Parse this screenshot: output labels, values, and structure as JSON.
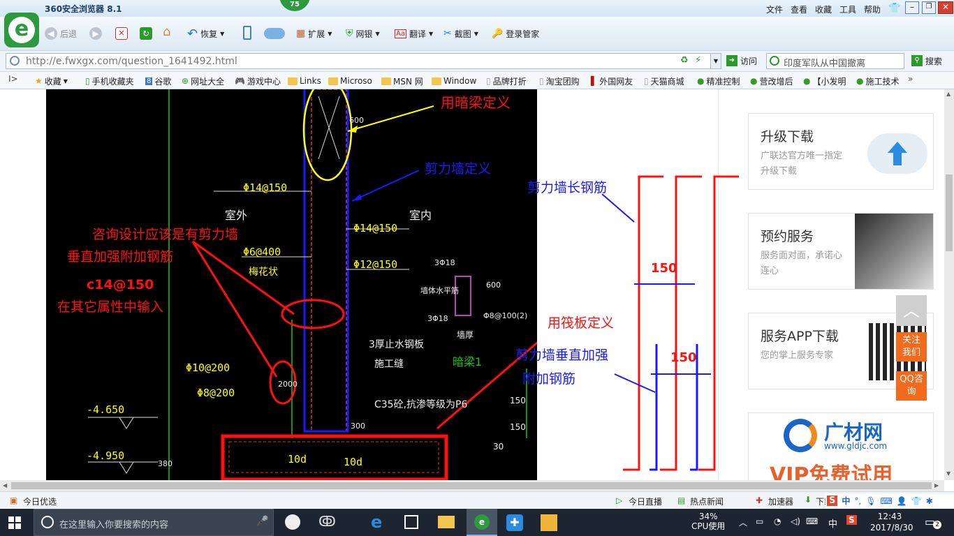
{
  "browser": {
    "title": "360安全浏览器 8.1",
    "badge": "75",
    "menu": [
      "文件",
      "查看",
      "收藏",
      "工具",
      "帮助"
    ],
    "nav": {
      "back": "后退",
      "restore": "恢复"
    },
    "tools": [
      "扩展",
      "网银",
      "翻译",
      "截图",
      "登录管家"
    ],
    "address": "http://e.fwxgx.com/question_1641492.html",
    "visit": "访问",
    "search_placeholder": "印度军队从中国撤离",
    "search_button": "搜索",
    "favorites": [
      "收藏",
      "手机收藏夹",
      "谷歌",
      "网址大全",
      "游戏中心",
      "Links",
      "Microso",
      "MSN 网",
      "Window",
      "品牌打折",
      "淘宝团购",
      "外国网友",
      "天猫商城",
      "精准控制",
      "营改增后",
      "【小发明",
      "施工技术"
    ]
  },
  "drawing": {
    "labels_red": [
      "用暗梁定义",
      "咨询设计应该是有剪力墙",
      "垂直加强附加钢筋",
      "c14@150",
      "在其它属性中输入",
      "用筏板定义"
    ],
    "labels_blue": [
      "剪力墙定义",
      "剪力墙垂直加强",
      "附加钢筋"
    ],
    "cad_text": [
      "Φ14@150",
      "室外",
      "室内",
      "Φ14@150",
      "Φ6@400",
      "梅花状",
      "Φ12@150",
      "3Φ18",
      "墙体水平筋",
      "3Φ18",
      "Φ8@100(2)",
      "600",
      "3厚止水钢板",
      "施工缝",
      "墙厚",
      "暗梁1",
      "C35砼,抗渗等级为P6",
      "Φ10@200",
      "Φ8@200",
      "2000",
      "300",
      "150",
      "150",
      "30",
      "10d",
      "10d",
      "-4.650",
      "-4.950",
      "380",
      "600"
    ],
    "sketch": {
      "title": "剪力墙长钢筋",
      "dim1": "150",
      "dim2": "150"
    }
  },
  "sidebar": {
    "cards": [
      {
        "title": "升级下载",
        "sub": "广联达官方唯一指定升级下载"
      },
      {
        "title": "预约服务",
        "sub": "服务面对面，承诺心连心"
      },
      {
        "title": "服务APP下载",
        "sub": "您的掌上服务专家"
      }
    ],
    "float": {
      "follow": "关注我们",
      "qq": "QQ咨询"
    },
    "ad": {
      "brand": "广材网",
      "url": "www.gldjc.com",
      "vip": "VIP免费试用"
    }
  },
  "statusbar": {
    "left": "今日优选",
    "items": [
      "今日直播",
      "热点新闻",
      "加速器",
      "下载"
    ]
  },
  "taskbar": {
    "search": "在这里输入你要搜索的内容",
    "cpu_pct": "34%",
    "cpu_label": "CPU使用",
    "ime": "中",
    "time": "12:43",
    "date": "2017/8/30",
    "notif": "2"
  },
  "colors": {
    "accent": "#2d9a3f",
    "cad_bg": "#000000",
    "red": "#ff1010",
    "blue": "#1010ff",
    "yellow": "#ffff00"
  }
}
